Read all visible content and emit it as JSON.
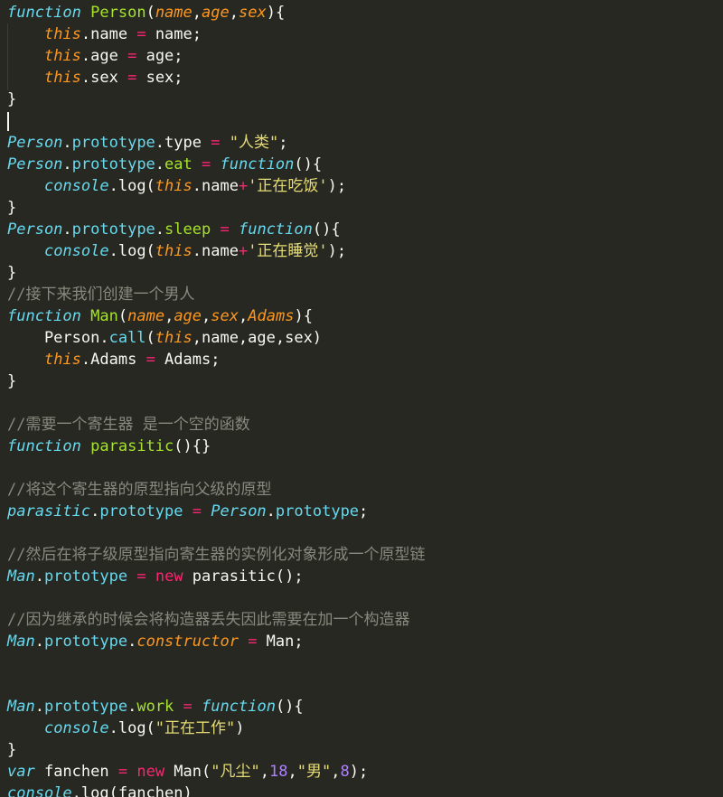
{
  "editor": {
    "name": "code-editor",
    "language": "JavaScript",
    "theme": "Monokai",
    "background_color": "#272822",
    "font_size_px": 17,
    "line_height_px": 24,
    "caret": {
      "visible": true,
      "line_index": 5,
      "column": 0
    },
    "colors": {
      "default_text": "#f8f8f2",
      "keyword": "#66d9ef",
      "keyword_operator": "#f92672",
      "function_name": "#a6e22e",
      "parameter": "#fd971f",
      "class_name": "#66d9ef",
      "property": "#66d9ef",
      "string": "#e6db74",
      "number": "#ae81ff",
      "operator": "#f92672",
      "comment": "#88897e",
      "indent_guide": "#3b3c35"
    },
    "lines": [
      {
        "n": 1,
        "tokens": [
          {
            "t": "function",
            "c": "t-kw"
          },
          {
            "t": " ",
            "c": "t-plain"
          },
          {
            "t": "Person",
            "c": "t-fn"
          },
          {
            "t": "(",
            "c": "t-plain"
          },
          {
            "t": "name",
            "c": "t-param"
          },
          {
            "t": ",",
            "c": "t-plain"
          },
          {
            "t": "age",
            "c": "t-param"
          },
          {
            "t": ",",
            "c": "t-plain"
          },
          {
            "t": "sex",
            "c": "t-param"
          },
          {
            "t": ")",
            "c": "t-plain"
          },
          {
            "t": "{",
            "c": "t-plain"
          }
        ]
      },
      {
        "n": 2,
        "tokens": [
          {
            "t": "    ",
            "c": "t-plain"
          },
          {
            "t": "this",
            "c": "t-this"
          },
          {
            "t": ".name ",
            "c": "t-plain"
          },
          {
            "t": "=",
            "c": "t-op"
          },
          {
            "t": " name;",
            "c": "t-plain"
          }
        ]
      },
      {
        "n": 3,
        "tokens": [
          {
            "t": "    ",
            "c": "t-plain"
          },
          {
            "t": "this",
            "c": "t-this"
          },
          {
            "t": ".age ",
            "c": "t-plain"
          },
          {
            "t": "=",
            "c": "t-op"
          },
          {
            "t": " age;",
            "c": "t-plain"
          }
        ]
      },
      {
        "n": 4,
        "tokens": [
          {
            "t": "    ",
            "c": "t-plain"
          },
          {
            "t": "this",
            "c": "t-this"
          },
          {
            "t": ".sex ",
            "c": "t-plain"
          },
          {
            "t": "=",
            "c": "t-op"
          },
          {
            "t": " sex;",
            "c": "t-plain"
          }
        ]
      },
      {
        "n": 5,
        "tokens": [
          {
            "t": "}",
            "c": "t-plain"
          }
        ]
      },
      {
        "n": 6,
        "tokens": []
      },
      {
        "n": 7,
        "tokens": [
          {
            "t": "Person",
            "c": "t-cls"
          },
          {
            "t": ".",
            "c": "t-plain"
          },
          {
            "t": "prototype",
            "c": "t-prop"
          },
          {
            "t": ".type ",
            "c": "t-plain"
          },
          {
            "t": "=",
            "c": "t-op"
          },
          {
            "t": " ",
            "c": "t-plain"
          },
          {
            "t": "\"人类\"",
            "c": "t-str"
          },
          {
            "t": ";",
            "c": "t-plain"
          }
        ]
      },
      {
        "n": 8,
        "tokens": [
          {
            "t": "Person",
            "c": "t-cls"
          },
          {
            "t": ".",
            "c": "t-plain"
          },
          {
            "t": "prototype",
            "c": "t-prop"
          },
          {
            "t": ".",
            "c": "t-plain"
          },
          {
            "t": "eat",
            "c": "t-fn"
          },
          {
            "t": " ",
            "c": "t-plain"
          },
          {
            "t": "=",
            "c": "t-op"
          },
          {
            "t": " ",
            "c": "t-plain"
          },
          {
            "t": "function",
            "c": "t-kw"
          },
          {
            "t": "(){",
            "c": "t-plain"
          }
        ]
      },
      {
        "n": 9,
        "tokens": [
          {
            "t": "    ",
            "c": "t-plain"
          },
          {
            "t": "console",
            "c": "t-cls"
          },
          {
            "t": ".log(",
            "c": "t-plain"
          },
          {
            "t": "this",
            "c": "t-this"
          },
          {
            "t": ".name",
            "c": "t-plain"
          },
          {
            "t": "+",
            "c": "t-op"
          },
          {
            "t": "'正在吃饭'",
            "c": "t-str"
          },
          {
            "t": ");",
            "c": "t-plain"
          }
        ]
      },
      {
        "n": 10,
        "tokens": [
          {
            "t": "}",
            "c": "t-plain"
          }
        ]
      },
      {
        "n": 11,
        "tokens": [
          {
            "t": "Person",
            "c": "t-cls"
          },
          {
            "t": ".",
            "c": "t-plain"
          },
          {
            "t": "prototype",
            "c": "t-prop"
          },
          {
            "t": ".",
            "c": "t-plain"
          },
          {
            "t": "sleep",
            "c": "t-fn"
          },
          {
            "t": " ",
            "c": "t-plain"
          },
          {
            "t": "=",
            "c": "t-op"
          },
          {
            "t": " ",
            "c": "t-plain"
          },
          {
            "t": "function",
            "c": "t-kw"
          },
          {
            "t": "(){",
            "c": "t-plain"
          }
        ]
      },
      {
        "n": 12,
        "tokens": [
          {
            "t": "    ",
            "c": "t-plain"
          },
          {
            "t": "console",
            "c": "t-cls"
          },
          {
            "t": ".log(",
            "c": "t-plain"
          },
          {
            "t": "this",
            "c": "t-this"
          },
          {
            "t": ".name",
            "c": "t-plain"
          },
          {
            "t": "+",
            "c": "t-op"
          },
          {
            "t": "'正在睡觉'",
            "c": "t-str"
          },
          {
            "t": ");",
            "c": "t-plain"
          }
        ]
      },
      {
        "n": 13,
        "tokens": [
          {
            "t": "}",
            "c": "t-plain"
          }
        ]
      },
      {
        "n": 14,
        "tokens": [
          {
            "t": "//接下来我们创建一个男人",
            "c": "t-comment"
          }
        ]
      },
      {
        "n": 15,
        "tokens": [
          {
            "t": "function",
            "c": "t-kw"
          },
          {
            "t": " ",
            "c": "t-plain"
          },
          {
            "t": "Man",
            "c": "t-fn"
          },
          {
            "t": "(",
            "c": "t-plain"
          },
          {
            "t": "name",
            "c": "t-param"
          },
          {
            "t": ",",
            "c": "t-plain"
          },
          {
            "t": "age",
            "c": "t-param"
          },
          {
            "t": ",",
            "c": "t-plain"
          },
          {
            "t": "sex",
            "c": "t-param"
          },
          {
            "t": ",",
            "c": "t-plain"
          },
          {
            "t": "Adams",
            "c": "t-param"
          },
          {
            "t": ")",
            "c": "t-plain"
          },
          {
            "t": "{",
            "c": "t-plain"
          }
        ]
      },
      {
        "n": 16,
        "tokens": [
          {
            "t": "    Person.",
            "c": "t-plain"
          },
          {
            "t": "call",
            "c": "t-prop"
          },
          {
            "t": "(",
            "c": "t-plain"
          },
          {
            "t": "this",
            "c": "t-this"
          },
          {
            "t": ",name,age,sex)",
            "c": "t-plain"
          }
        ]
      },
      {
        "n": 17,
        "tokens": [
          {
            "t": "    ",
            "c": "t-plain"
          },
          {
            "t": "this",
            "c": "t-this"
          },
          {
            "t": ".Adams ",
            "c": "t-plain"
          },
          {
            "t": "=",
            "c": "t-op"
          },
          {
            "t": " Adams;",
            "c": "t-plain"
          }
        ]
      },
      {
        "n": 18,
        "tokens": [
          {
            "t": "}",
            "c": "t-plain"
          }
        ]
      },
      {
        "n": 19,
        "tokens": []
      },
      {
        "n": 20,
        "tokens": [
          {
            "t": "//需要一个寄生器 是一个空的函数",
            "c": "t-comment"
          }
        ]
      },
      {
        "n": 21,
        "tokens": [
          {
            "t": "function",
            "c": "t-kw"
          },
          {
            "t": " ",
            "c": "t-plain"
          },
          {
            "t": "parasitic",
            "c": "t-fn"
          },
          {
            "t": "(){}",
            "c": "t-plain"
          }
        ]
      },
      {
        "n": 22,
        "tokens": []
      },
      {
        "n": 23,
        "tokens": [
          {
            "t": "//将这个寄生器的原型指向父级的原型",
            "c": "t-comment"
          }
        ]
      },
      {
        "n": 24,
        "tokens": [
          {
            "t": "parasitic",
            "c": "t-cls"
          },
          {
            "t": ".",
            "c": "t-plain"
          },
          {
            "t": "prototype",
            "c": "t-prop"
          },
          {
            "t": " ",
            "c": "t-plain"
          },
          {
            "t": "=",
            "c": "t-op"
          },
          {
            "t": " ",
            "c": "t-plain"
          },
          {
            "t": "Person",
            "c": "t-cls"
          },
          {
            "t": ".",
            "c": "t-plain"
          },
          {
            "t": "prototype",
            "c": "t-prop"
          },
          {
            "t": ";",
            "c": "t-plain"
          }
        ]
      },
      {
        "n": 25,
        "tokens": []
      },
      {
        "n": 26,
        "tokens": [
          {
            "t": "//然后在将子级原型指向寄生器的实例化对象形成一个原型链",
            "c": "t-comment"
          }
        ]
      },
      {
        "n": 27,
        "tokens": [
          {
            "t": "Man",
            "c": "t-cls"
          },
          {
            "t": ".",
            "c": "t-plain"
          },
          {
            "t": "prototype",
            "c": "t-prop"
          },
          {
            "t": " ",
            "c": "t-plain"
          },
          {
            "t": "=",
            "c": "t-op"
          },
          {
            "t": " ",
            "c": "t-plain"
          },
          {
            "t": "new",
            "c": "t-kw2"
          },
          {
            "t": " parasitic();",
            "c": "t-plain"
          }
        ]
      },
      {
        "n": 28,
        "tokens": []
      },
      {
        "n": 29,
        "tokens": [
          {
            "t": "//因为继承的时候会将构造器丢失因此需要在加一个构造器",
            "c": "t-comment"
          }
        ]
      },
      {
        "n": 30,
        "tokens": [
          {
            "t": "Man",
            "c": "t-cls"
          },
          {
            "t": ".",
            "c": "t-plain"
          },
          {
            "t": "prototype",
            "c": "t-prop"
          },
          {
            "t": ".",
            "c": "t-plain"
          },
          {
            "t": "constructor",
            "c": "t-param"
          },
          {
            "t": " ",
            "c": "t-plain"
          },
          {
            "t": "=",
            "c": "t-op"
          },
          {
            "t": " Man;",
            "c": "t-plain"
          }
        ]
      },
      {
        "n": 31,
        "tokens": []
      },
      {
        "n": 32,
        "tokens": []
      },
      {
        "n": 33,
        "tokens": [
          {
            "t": "Man",
            "c": "t-cls"
          },
          {
            "t": ".",
            "c": "t-plain"
          },
          {
            "t": "prototype",
            "c": "t-prop"
          },
          {
            "t": ".",
            "c": "t-plain"
          },
          {
            "t": "work",
            "c": "t-fn"
          },
          {
            "t": " ",
            "c": "t-plain"
          },
          {
            "t": "=",
            "c": "t-op"
          },
          {
            "t": " ",
            "c": "t-plain"
          },
          {
            "t": "function",
            "c": "t-kw"
          },
          {
            "t": "(){",
            "c": "t-plain"
          }
        ]
      },
      {
        "n": 34,
        "tokens": [
          {
            "t": "    ",
            "c": "t-plain"
          },
          {
            "t": "console",
            "c": "t-cls"
          },
          {
            "t": ".log(",
            "c": "t-plain"
          },
          {
            "t": "\"正在工作\"",
            "c": "t-str"
          },
          {
            "t": ")",
            "c": "t-plain"
          }
        ]
      },
      {
        "n": 35,
        "tokens": [
          {
            "t": "}",
            "c": "t-plain"
          }
        ]
      },
      {
        "n": 36,
        "tokens": [
          {
            "t": "var",
            "c": "t-kw"
          },
          {
            "t": " fanchen ",
            "c": "t-plain"
          },
          {
            "t": "=",
            "c": "t-op"
          },
          {
            "t": " ",
            "c": "t-plain"
          },
          {
            "t": "new",
            "c": "t-kw2"
          },
          {
            "t": " Man(",
            "c": "t-plain"
          },
          {
            "t": "\"凡尘\"",
            "c": "t-str"
          },
          {
            "t": ",",
            "c": "t-plain"
          },
          {
            "t": "18",
            "c": "t-num"
          },
          {
            "t": ",",
            "c": "t-plain"
          },
          {
            "t": "\"男\"",
            "c": "t-str"
          },
          {
            "t": ",",
            "c": "t-plain"
          },
          {
            "t": "8",
            "c": "t-num"
          },
          {
            "t": ");",
            "c": "t-plain"
          }
        ]
      },
      {
        "n": 37,
        "tokens": [
          {
            "t": "console",
            "c": "t-cls"
          },
          {
            "t": ".log(fanchen)",
            "c": "t-plain"
          }
        ]
      }
    ]
  }
}
